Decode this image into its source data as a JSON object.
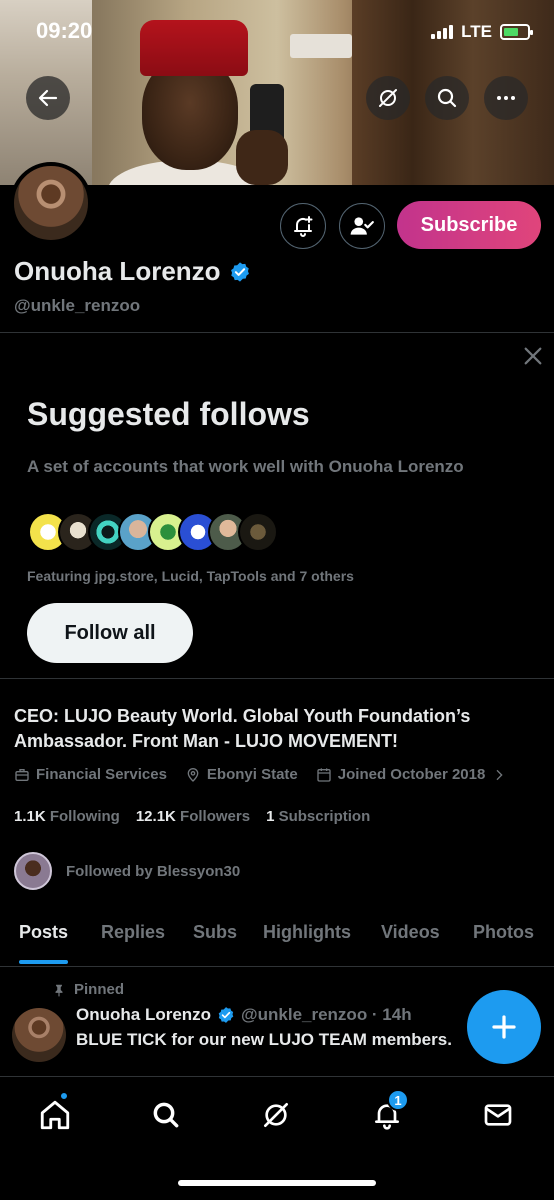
{
  "status_bar": {
    "time": "09:20",
    "network": "LTE"
  },
  "profile": {
    "display_name": "Onuoha Lorenzo",
    "handle": "@unkle_renzoo",
    "subscribe_label": "Subscribe",
    "bio": "CEO: LUJO Beauty World. Global Youth Foundation’s Ambassador. Front Man - LUJO MOVEMENT!",
    "category": "Financial Services",
    "location": "Ebonyi State",
    "joined": "Joined October 2018",
    "following_count": "1.1K",
    "following_label": "Following",
    "followers_count": "12.1K",
    "followers_label": "Followers",
    "subscriptions_count": "1",
    "subscriptions_label": "Subscription",
    "followed_by": "Followed by Blessyon30"
  },
  "suggested": {
    "title": "Suggested follows",
    "subtitle": "A set of accounts that work well with Onuoha Lorenzo",
    "featuring": "Featuring jpg.store, Lucid, TapTools and 7 others",
    "follow_all_label": "Follow all"
  },
  "tabs": [
    {
      "label": "Posts"
    },
    {
      "label": "Replies"
    },
    {
      "label": "Subs"
    },
    {
      "label": "Highlights"
    },
    {
      "label": "Videos"
    },
    {
      "label": "Photos"
    }
  ],
  "pinned_post": {
    "pinned_label": "Pinned",
    "author": "Onuoha Lorenzo",
    "handle_time": "@unkle_renzoo · 14h",
    "text": "BLUE TICK for our new LUJO TEAM members."
  },
  "bottom_nav": {
    "notifications_badge": "1"
  },
  "colors": {
    "accent": "#1d9bf0",
    "subscribe_start": "#c2338c",
    "subscribe_end": "#e0457b"
  }
}
